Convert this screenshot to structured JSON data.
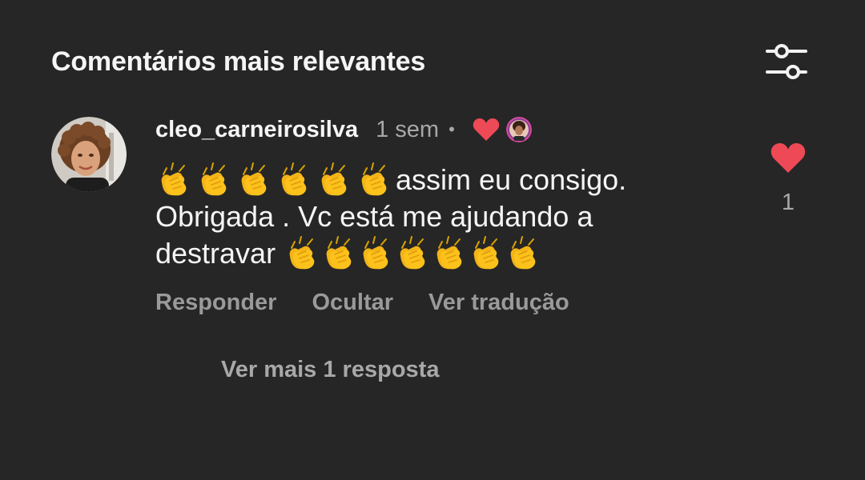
{
  "header": {
    "title": "Comentários mais relevantes",
    "filter_icon": "sliders-icon"
  },
  "comment": {
    "username": "cleo_carneirosilva",
    "timestamp": "1 sem",
    "separator": "•",
    "creator_liked": true,
    "text_part1": "assim eu consigo. Obrigada . Vc está me ajudando a destravar ",
    "leading_claps": 6,
    "trailing_claps": 7,
    "emoji": "clapping-hands-emoji",
    "actions": {
      "reply": "Responder",
      "hide": "Ocultar",
      "translate": "Ver tradução"
    },
    "like_count": "1",
    "heart_color": "#ed4956"
  },
  "more_replies": "Ver mais 1 resposta"
}
